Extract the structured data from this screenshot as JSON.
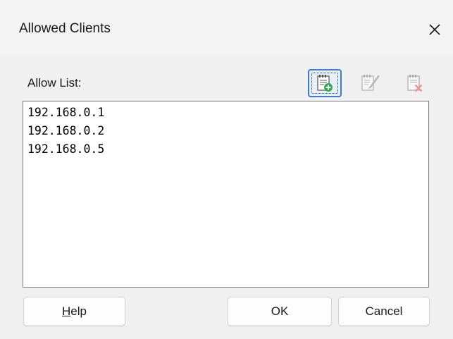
{
  "window": {
    "title": "Allowed Clients",
    "close_glyph": "✕"
  },
  "allow_list": {
    "label": "Allow List:",
    "items": [
      "192.168.0.1",
      "192.168.0.2",
      "192.168.0.5"
    ]
  },
  "toolbar": {
    "buttons": [
      {
        "icon": "add-document-icon",
        "state": "focused"
      },
      {
        "icon": "edit-document-icon",
        "state": "disabled"
      },
      {
        "icon": "delete-document-icon",
        "state": "disabled"
      }
    ]
  },
  "buttons": {
    "help_mnemonic": "H",
    "help_rest": "elp",
    "ok": "OK",
    "cancel": "Cancel"
  },
  "colors": {
    "accent": "#3a7bd5",
    "add_green": "#2fa84f",
    "delete_red": "#e04343"
  }
}
